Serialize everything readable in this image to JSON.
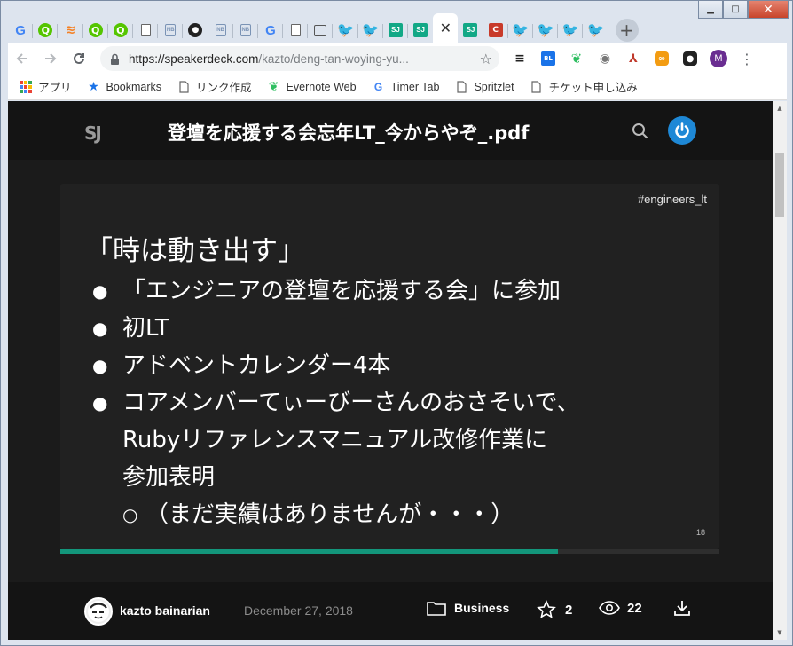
{
  "browser": {
    "tabs": [
      {
        "icon": "google-icon",
        "glyph": "G"
      },
      {
        "icon": "qiita-icon",
        "glyph": "Q"
      },
      {
        "icon": "stackoverflow-icon",
        "glyph": "≋"
      },
      {
        "icon": "qiita-icon",
        "glyph": "Q"
      },
      {
        "icon": "qiita-icon",
        "glyph": "Q"
      },
      {
        "icon": "document-icon",
        "glyph": ""
      },
      {
        "icon": "notebook-icon",
        "glyph": "NB"
      },
      {
        "icon": "github-icon",
        "glyph": "●"
      },
      {
        "icon": "notebook-icon",
        "glyph": "NB"
      },
      {
        "icon": "notebook-icon",
        "glyph": "NB"
      },
      {
        "icon": "google-icon",
        "glyph": "G"
      },
      {
        "icon": "document-icon",
        "glyph": ""
      },
      {
        "icon": "reader-icon",
        "glyph": ""
      },
      {
        "icon": "twitter-icon",
        "glyph": "🐦"
      },
      {
        "icon": "twitter-icon",
        "glyph": "🐦"
      },
      {
        "icon": "speakerdeck-icon",
        "glyph": "SJ"
      },
      {
        "icon": "speakerdeck-icon",
        "glyph": "SJ"
      },
      {
        "icon": "close-icon",
        "glyph": "✕",
        "active": true
      },
      {
        "icon": "speakerdeck-icon",
        "glyph": "SJ"
      },
      {
        "icon": "clipper-icon",
        "glyph": "C"
      },
      {
        "icon": "twitter-icon",
        "glyph": "🐦"
      },
      {
        "icon": "twitter-icon",
        "glyph": "🐦"
      },
      {
        "icon": "twitter-icon",
        "glyph": "🐦"
      },
      {
        "icon": "twitter-icon",
        "glyph": "🐦"
      }
    ],
    "new_tab": "+",
    "window_controls": {
      "minimize": "▁",
      "maximize": "□",
      "close": "✕"
    },
    "url_host": "https://speakerdeck.com",
    "url_path": "/kazto/deng-tan-woying-yu...",
    "profile_initial": "M",
    "bookmarks": [
      {
        "label": "アプリ",
        "icon": "apps-grid-icon"
      },
      {
        "label": "Bookmarks",
        "icon": "star-icon"
      },
      {
        "label": "リンク作成",
        "icon": "document-icon"
      },
      {
        "label": "Evernote Web",
        "icon": "evernote-icon"
      },
      {
        "label": "Timer Tab",
        "icon": "google-icon"
      },
      {
        "label": "Spritzlet",
        "icon": "document-icon"
      },
      {
        "label": "チケット申し込み",
        "icon": "document-icon"
      }
    ]
  },
  "page": {
    "site_logo": "SJ",
    "deck_title": "登壇を応援する会忘年LT_今からやぞ_.pdf",
    "slide": {
      "tag": "#engineers_lt",
      "heading": "「時は動き出す」",
      "bullets": [
        "「エンジニアの登壇を応援する会」に参加",
        "初LT",
        "アドベントカレンダー4本"
      ],
      "last_bullet_lines": [
        "コアメンバーてぃーびーさんのおさそいで、",
        "Rubyリファレンスマニュアル改修作業に",
        "参加表明"
      ],
      "sub_bullet": "（まだ実績はありませんが・・・）",
      "page_number": "18",
      "progress_percent": 75.5
    },
    "meta": {
      "author": "kazto bainarian",
      "date": "December 27, 2018",
      "category": "Business",
      "stars": "2",
      "views": "22"
    }
  },
  "colors": {
    "accent": "#13967b",
    "power": "#1e88d6",
    "background": "#141414"
  }
}
